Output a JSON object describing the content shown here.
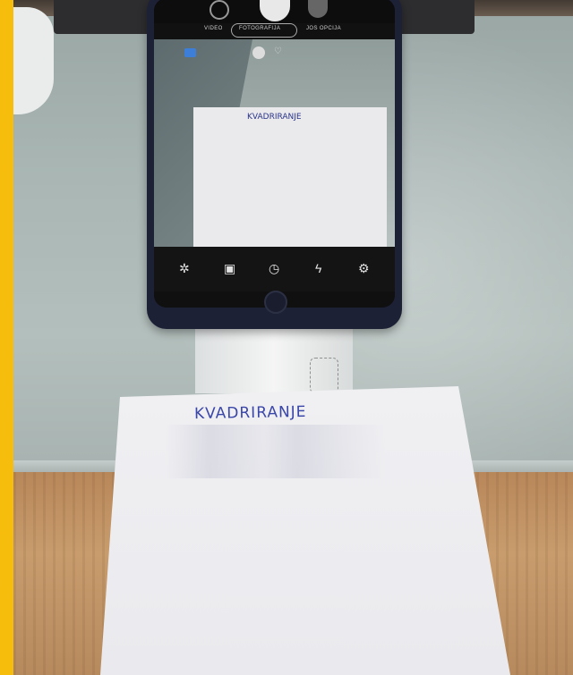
{
  "paper": {
    "text": "KVADRIRANJE"
  },
  "phone": {
    "modes": {
      "left": "VIDEO",
      "active": "FOTOGRAFIJA",
      "right": "JOS OPCIJA"
    },
    "viewfinder_text": "KVADRIRANJE",
    "toolbar_icons": [
      "sparkle-icon",
      "aspect-ratio-icon",
      "timer-icon",
      "flash-icon",
      "settings-icon"
    ]
  },
  "colors": {
    "accent_bar": "#f6bd0c",
    "ink": "#3a46a8"
  }
}
